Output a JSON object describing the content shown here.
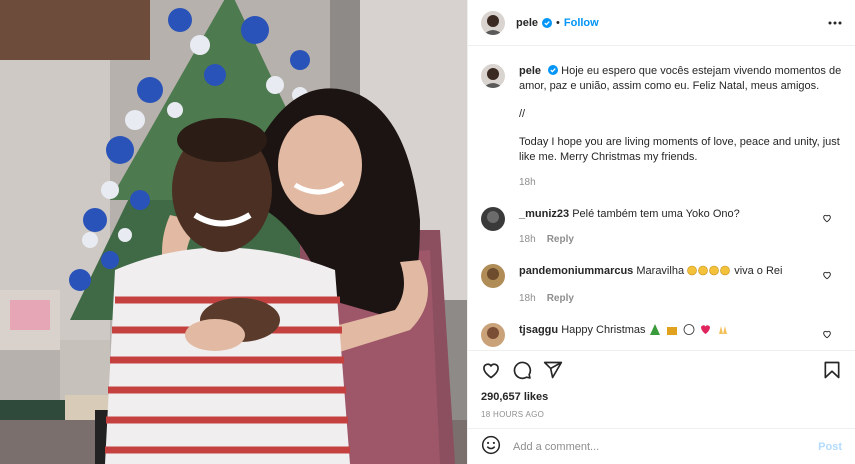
{
  "post": {
    "username": "pele",
    "follow_label": "Follow",
    "separator": "•",
    "caption_pt": "Hoje eu espero que vocês estejam vivendo momentos de amor, paz e união, assim como eu. Feliz Natal, meus amigos.",
    "caption_sep": "//",
    "caption_en": "Today I hope you are living moments of love, peace and unity, just like me. Merry Christmas my friends.",
    "caption_time": "18h",
    "likes": "290,657 likes",
    "time_ago": "18 HOURS AGO",
    "comment_placeholder": "Add a comment...",
    "post_label": "Post"
  },
  "comments": [
    {
      "username": "_muniz23",
      "text": "Pelé também tem uma Yoko Ono?",
      "time": "18h",
      "reply": "Reply",
      "avatar_color": "#3a3a3a"
    },
    {
      "username": "pandemoniummarcus",
      "text": "Maravilha",
      "text_after": "viva o Rei",
      "time": "18h",
      "reply": "Reply",
      "avatar_color": "#b08d57"
    },
    {
      "username": "tjsaggu",
      "text": "Happy Christmas",
      "avatar_color": "#c9a27a"
    }
  ],
  "icons": {
    "heart": "heart-icon",
    "comment": "comment-icon",
    "share": "share-icon",
    "save": "bookmark-icon",
    "emoji": "emoji-icon",
    "more": "more-icon",
    "verified": "verified-badge-icon"
  },
  "colors": {
    "accent": "#0095f6",
    "post_disabled": "#b3dbff",
    "muted": "#8e8e8e",
    "text": "#262626",
    "border": "#efefef"
  }
}
